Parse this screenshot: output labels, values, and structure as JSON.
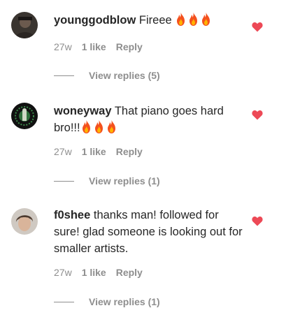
{
  "accent_heart_color": "#ed4956",
  "comments": [
    {
      "username": "younggodblow",
      "text": "Fireee",
      "fire_count": 3,
      "time": "27w",
      "likes": "1 like",
      "reply_label": "Reply",
      "view_replies": "View replies (5)"
    },
    {
      "username": "woneyway",
      "text": "That piano goes hard bro!!!",
      "fire_count": 3,
      "time": "27w",
      "likes": "1 like",
      "reply_label": "Reply",
      "view_replies": "View replies (1)"
    },
    {
      "username": "f0shee",
      "text": "thanks man! followed for sure! glad someone is looking out for smaller artists.",
      "fire_count": 0,
      "time": "27w",
      "likes": "1 like",
      "reply_label": "Reply",
      "view_replies": "View replies (1)"
    }
  ]
}
